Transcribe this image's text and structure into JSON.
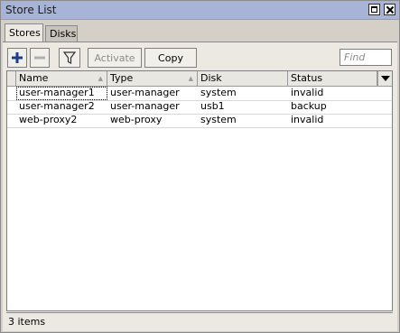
{
  "window": {
    "title": "Store List",
    "controls": [
      "maximize-icon",
      "close-icon"
    ]
  },
  "tabs": [
    {
      "label": "Stores",
      "active": true
    },
    {
      "label": "Disks",
      "active": false
    }
  ],
  "toolbar": {
    "add_icon": "plus-icon",
    "remove_icon": "minus-icon",
    "filter_icon": "filter-icon",
    "activate_label": "Activate",
    "copy_label": "Copy",
    "find_placeholder": "Find"
  },
  "table": {
    "columns": [
      "Name",
      "Type",
      "Disk",
      "Status"
    ],
    "rows": [
      {
        "name": "user-manager1",
        "type": "user-manager",
        "disk": "system",
        "status": "invalid"
      },
      {
        "name": "user-manager2",
        "type": "user-manager",
        "disk": "usb1",
        "status": "backup"
      },
      {
        "name": "web-proxy2",
        "type": "web-proxy",
        "disk": "system",
        "status": "invalid"
      }
    ]
  },
  "statusbar": {
    "text": "3 items"
  },
  "colors": {
    "titlebar": "#a7b4d8",
    "add_icon": "#1a3d8f"
  }
}
